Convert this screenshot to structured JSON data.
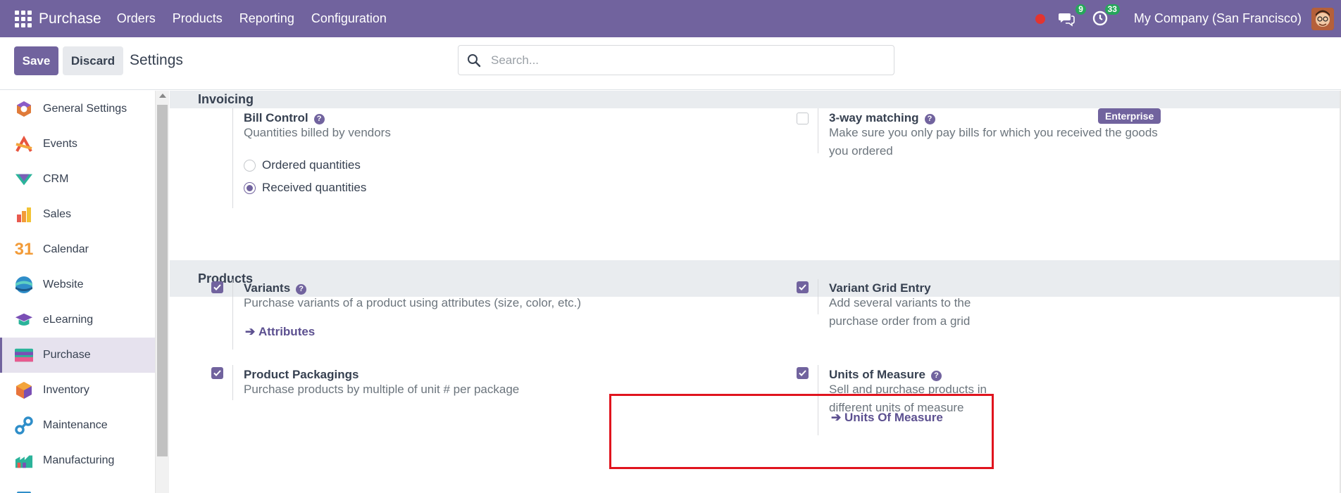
{
  "navbar": {
    "app_name": "Purchase",
    "menu": [
      "Orders",
      "Products",
      "Reporting",
      "Configuration"
    ],
    "messages_count": "9",
    "activities_count": "33",
    "company": "My Company (San Francisco)"
  },
  "control": {
    "save_label": "Save",
    "discard_label": "Discard",
    "title": "Settings",
    "search_placeholder": "Search..."
  },
  "sidebar": {
    "items": [
      {
        "label": "General Settings",
        "icon": "general-settings-icon"
      },
      {
        "label": "Events",
        "icon": "events-icon"
      },
      {
        "label": "CRM",
        "icon": "crm-icon"
      },
      {
        "label": "Sales",
        "icon": "sales-icon"
      },
      {
        "label": "Calendar",
        "icon": "calendar-icon",
        "glyph": "31"
      },
      {
        "label": "Website",
        "icon": "website-icon"
      },
      {
        "label": "eLearning",
        "icon": "elearning-icon"
      },
      {
        "label": "Purchase",
        "icon": "purchase-icon",
        "active": true
      },
      {
        "label": "Inventory",
        "icon": "inventory-icon"
      },
      {
        "label": "Maintenance",
        "icon": "maintenance-icon"
      },
      {
        "label": "Manufacturing",
        "icon": "manufacturing-icon"
      }
    ]
  },
  "invoicing": {
    "header": "Invoicing",
    "bill_control": {
      "title": "Bill Control",
      "desc": "Quantities billed by vendors",
      "options": [
        "Ordered quantities",
        "Received quantities"
      ],
      "selected": "Received quantities"
    },
    "three_way": {
      "title": "3-way matching",
      "badge": "Enterprise",
      "desc_line1": "Make sure you only pay bills for which you received the goods",
      "desc_line2": "you ordered",
      "checked": false
    }
  },
  "products": {
    "header": "Products",
    "variants": {
      "title": "Variants",
      "desc": "Purchase variants of a product using attributes (size, color, etc.)",
      "link": "Attributes",
      "checked": true
    },
    "variant_grid": {
      "title": "Variant Grid Entry",
      "desc": "Add several variants to the purchase order from a grid",
      "checked": true
    },
    "packagings": {
      "title": "Product Packagings",
      "desc": "Purchase products by multiple of unit # per package",
      "checked": true
    },
    "uom": {
      "title": "Units of Measure",
      "desc": "Sell and purchase products in different units of measure",
      "link": "Units Of Measure",
      "checked": true
    }
  },
  "help_glyph": "?",
  "arrow_glyph": "➔",
  "colors": {
    "brand": "#71639e",
    "highlight": "#e0141e",
    "badge_green": "#26a65b"
  }
}
